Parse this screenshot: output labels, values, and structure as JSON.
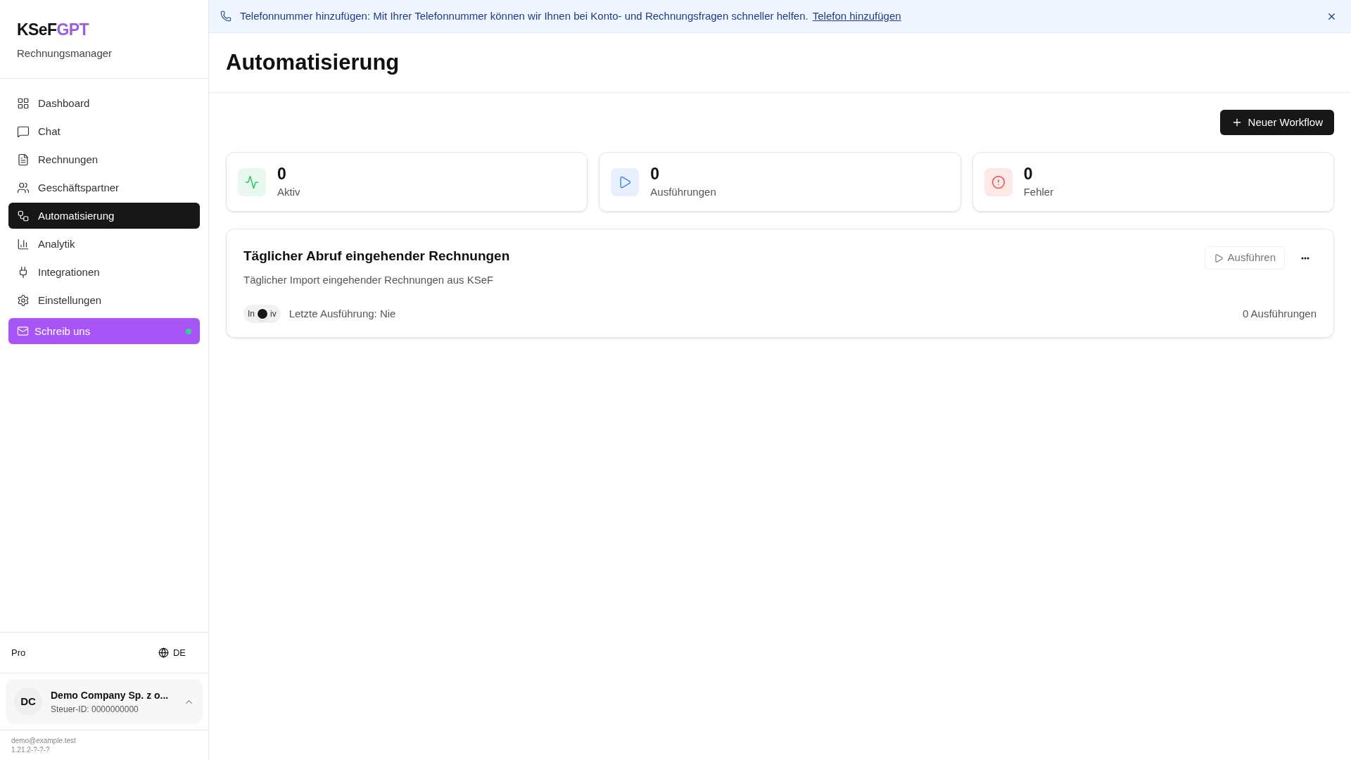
{
  "sidebar": {
    "logo": {
      "primary": "KSeF",
      "accent": "GPT"
    },
    "subtitle": "Rechnungsmanager",
    "items": [
      {
        "label": "Dashboard",
        "selected": false
      },
      {
        "label": "Chat",
        "selected": false
      },
      {
        "label": "Rechnungen",
        "selected": false
      },
      {
        "label": "Geschäftspartner",
        "selected": false
      },
      {
        "label": "Automatisierung",
        "selected": true
      },
      {
        "label": "Analytik",
        "selected": false
      },
      {
        "label": "Integrationen",
        "selected": false
      },
      {
        "label": "Einstellungen",
        "selected": false
      }
    ],
    "contact_button": {
      "label": "Schreib uns",
      "online": true
    },
    "plan": "Pro",
    "language": "DE",
    "account": {
      "initials": "DC",
      "name": "Demo Company Sp. z o...",
      "tax_id": "Steuer-ID: 0000000000"
    },
    "email": "demo@example.test",
    "version": "1.21.2-?-?-?"
  },
  "banner": {
    "text": "Telefonnummer hinzufügen: Mit Ihrer Telefonnummer können wir Ihnen bei Konto- und Rechnungsfragen schneller helfen.",
    "link": "Telefon hinzufügen"
  },
  "page": {
    "title": "Automatisierung",
    "new_button": "Neuer Workflow"
  },
  "stats": [
    {
      "value": "0",
      "label": "Aktiv",
      "kind": "active"
    },
    {
      "value": "0",
      "label": "Ausführungen",
      "kind": "runs"
    },
    {
      "value": "0",
      "label": "Fehler",
      "kind": "errors"
    }
  ],
  "workflows": [
    {
      "title": "Täglicher Abruf eingehender Rechnungen",
      "description": "Täglicher Import eingehender Rechnungen aus KSeF",
      "run_button": "Ausführen",
      "on": false,
      "status_parts": [
        "In",
        "iv"
      ],
      "last_run": "Letzte Ausführung: Nie",
      "run_count": "0 Ausführungen"
    }
  ]
}
